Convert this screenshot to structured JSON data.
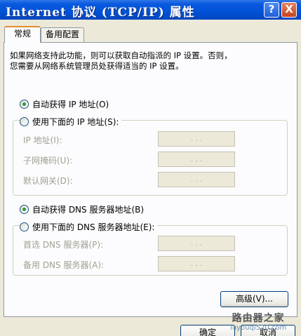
{
  "window": {
    "title": "Internet 协议 (TCP/IP) 属性",
    "help_label": "?",
    "close_label": "X"
  },
  "tabs": [
    {
      "label": "常规",
      "active": true
    },
    {
      "label": "备用配置",
      "active": false
    }
  ],
  "description": [
    "如果网络支持此功能，则可以获取自动指派的 IP 设置。否则，",
    "您需要从网络系统管理员处获得适当的 IP 设置。"
  ],
  "ip": {
    "auto_label": "自动获得 IP 地址(O)",
    "manual_label": "使用下面的 IP 地址(S):",
    "selected": "auto",
    "fields": [
      {
        "label": "IP 地址(I):",
        "value": ". . ."
      },
      {
        "label": "子网掩码(U):",
        "value": ". . ."
      },
      {
        "label": "默认网关(D):",
        "value": ". . ."
      }
    ]
  },
  "dns": {
    "auto_label": "自动获得 DNS 服务器地址(B)",
    "manual_label": "使用下面的 DNS 服务器地址(E):",
    "selected": "auto",
    "fields": [
      {
        "label": "首选 DNS 服务器(P):",
        "value": ". . ."
      },
      {
        "label": "备用 DNS 服务器(A):",
        "value": ". . ."
      }
    ]
  },
  "buttons": {
    "advanced": "高级(V)...",
    "ok": "确定",
    "cancel": "取消"
  },
  "watermark": {
    "main": "路由器之家",
    "sub": "luyouqi520.com"
  },
  "colors": {
    "titlebar": "#0052d6",
    "tab_accent": "#e68b2c",
    "radio_dot": "#2f9a2f"
  }
}
